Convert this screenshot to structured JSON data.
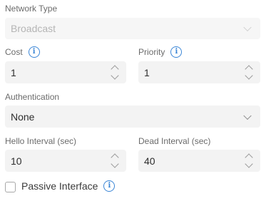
{
  "network_type": {
    "label": "Network Type",
    "value": "Broadcast"
  },
  "cost": {
    "label": "Cost",
    "value": "1"
  },
  "priority": {
    "label": "Priority",
    "value": "1"
  },
  "authentication": {
    "label": "Authentication",
    "value": "None"
  },
  "hello_interval": {
    "label": "Hello Interval (sec)",
    "value": "10"
  },
  "dead_interval": {
    "label": "Dead Interval (sec)",
    "value": "40"
  },
  "passive_interface": {
    "label": "Passive Interface",
    "checked": false
  },
  "info_glyph": "i",
  "colors": {
    "accent": "#3b86d6",
    "field_bg": "#f3f3f3",
    "label": "#6b6b6b"
  }
}
